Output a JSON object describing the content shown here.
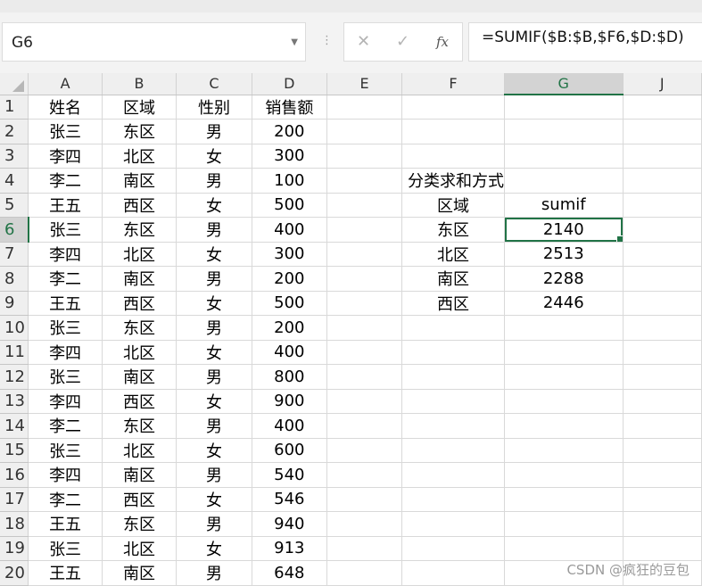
{
  "name_box": "G6",
  "formula": "=SUMIF($B:$B,$F6,$D:$D)",
  "colors": {
    "accent": "#217346",
    "header_bg": "#efefef",
    "header_selected": "#d3d3d3"
  },
  "icons": {
    "cancel": "✕",
    "confirm": "✓",
    "function": "fx",
    "dropdown": "▼",
    "more": "⋮"
  },
  "columns": [
    "A",
    "B",
    "C",
    "D",
    "E",
    "F",
    "G",
    "J"
  ],
  "rows": [
    {
      "n": "1",
      "a": "姓名",
      "b": "区域",
      "c": "性别",
      "d": "销售额",
      "f": "",
      "g": ""
    },
    {
      "n": "2",
      "a": "张三",
      "b": "东区",
      "c": "男",
      "d": "200",
      "f": "",
      "g": ""
    },
    {
      "n": "3",
      "a": "李四",
      "b": "北区",
      "c": "女",
      "d": "300",
      "f": "",
      "g": ""
    },
    {
      "n": "4",
      "a": "李二",
      "b": "南区",
      "c": "男",
      "d": "100",
      "f": "分类求和方式",
      "g": ""
    },
    {
      "n": "5",
      "a": "王五",
      "b": "西区",
      "c": "女",
      "d": "500",
      "f": "区域",
      "g": "sumif"
    },
    {
      "n": "6",
      "a": "张三",
      "b": "东区",
      "c": "男",
      "d": "400",
      "f": "东区",
      "g": "2140"
    },
    {
      "n": "7",
      "a": "李四",
      "b": "北区",
      "c": "女",
      "d": "300",
      "f": "北区",
      "g": "2513"
    },
    {
      "n": "8",
      "a": "李二",
      "b": "南区",
      "c": "男",
      "d": "200",
      "f": "南区",
      "g": "2288"
    },
    {
      "n": "9",
      "a": "王五",
      "b": "西区",
      "c": "女",
      "d": "500",
      "f": "西区",
      "g": "2446"
    },
    {
      "n": "10",
      "a": "张三",
      "b": "东区",
      "c": "男",
      "d": "200",
      "f": "",
      "g": ""
    },
    {
      "n": "11",
      "a": "李四",
      "b": "北区",
      "c": "女",
      "d": "400",
      "f": "",
      "g": ""
    },
    {
      "n": "12",
      "a": "张三",
      "b": "南区",
      "c": "男",
      "d": "800",
      "f": "",
      "g": ""
    },
    {
      "n": "13",
      "a": "李四",
      "b": "西区",
      "c": "女",
      "d": "900",
      "f": "",
      "g": ""
    },
    {
      "n": "14",
      "a": "李二",
      "b": "东区",
      "c": "男",
      "d": "400",
      "f": "",
      "g": ""
    },
    {
      "n": "15",
      "a": "张三",
      "b": "北区",
      "c": "女",
      "d": "600",
      "f": "",
      "g": ""
    },
    {
      "n": "16",
      "a": "李四",
      "b": "南区",
      "c": "男",
      "d": "540",
      "f": "",
      "g": ""
    },
    {
      "n": "17",
      "a": "李二",
      "b": "西区",
      "c": "女",
      "d": "546",
      "f": "",
      "g": ""
    },
    {
      "n": "18",
      "a": "王五",
      "b": "东区",
      "c": "男",
      "d": "940",
      "f": "",
      "g": ""
    },
    {
      "n": "19",
      "a": "张三",
      "b": "北区",
      "c": "女",
      "d": "913",
      "f": "",
      "g": ""
    },
    {
      "n": "20",
      "a": "王五",
      "b": "南区",
      "c": "男",
      "d": "648",
      "f": "",
      "g": ""
    }
  ],
  "watermark": "CSDN @疯狂的豆包"
}
